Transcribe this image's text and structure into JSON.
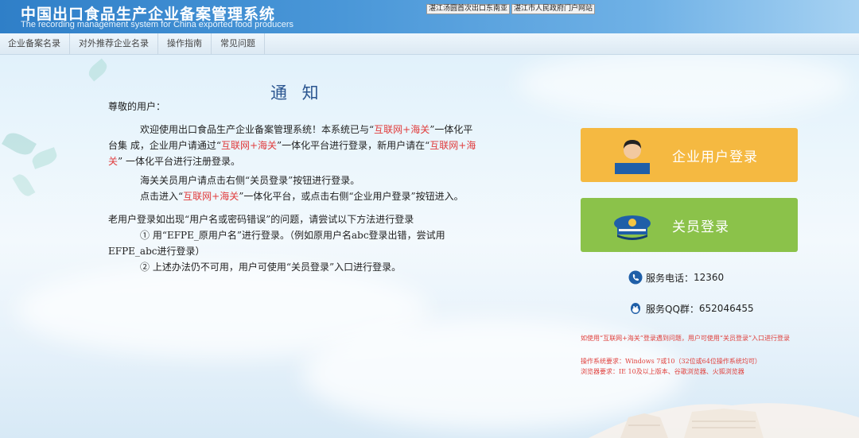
{
  "header": {
    "title_cn": "中国出口食品生产企业备案管理系统",
    "title_en": "The recording management system for China exported food producers",
    "links": [
      "湛江汤圆首次出口东南亚",
      "湛江市人民政府门户网站"
    ]
  },
  "nav": {
    "items": [
      "企业备案名录",
      "对外推荐企业名录",
      "操作指南",
      "常见问题"
    ]
  },
  "notice": {
    "title": "通 知",
    "greeting": "尊敬的用户：",
    "p1_a": "欢迎使用出口食品生产企业备案管理系统！本系统已与“",
    "p1_red1": "互联网+海关",
    "p1_b": "”一体化平台集 成，企业用户请通过“",
    "p1_red2": "互联网+海关",
    "p1_c": "”一体化平台进行登录，新用户请在“",
    "p1_red3": "互联网+海关",
    "p1_d": "” 一体化平台进行注册登录。",
    "p2": "海关关员用户请点击右侧“关员登录”按钮进行登录。",
    "p3_a": "点击进入“",
    "p3_red": "互联网+海关",
    "p3_b": "”一体化平台，或点击右侧“企业用户登录”按钮进入。",
    "p4": "老用户登录如出现“用户名或密码错误”的问题，请尝试以下方法进行登录",
    "p5": "① 用“EFPE_原用户名”进行登录。（例如原用户名abc登录出错，尝试用EFPE_abc进行登录）",
    "p6": "② 上述办法仍不可用，用户可使用“关员登录”入口进行登录。"
  },
  "login": {
    "corp_label": "企业用户登录",
    "officer_label": "关员登录",
    "corp_color": "#f5b941",
    "officer_color": "#8bc24a"
  },
  "service": {
    "phone_label": "服务电话：",
    "phone": "12360",
    "qq_label": "服务QQ群：",
    "qq": "652046455"
  },
  "tips": {
    "t1": "如使用“互联网+海关”登录遇到问题，用户可使用“关员登录”入口进行登录",
    "t2": "操作系统要求：Windows 7或10（32位或64位操作系统均可）",
    "t3": "浏览器要求：IE 10及以上版本、谷歌浏览器、火狐浏览器"
  }
}
